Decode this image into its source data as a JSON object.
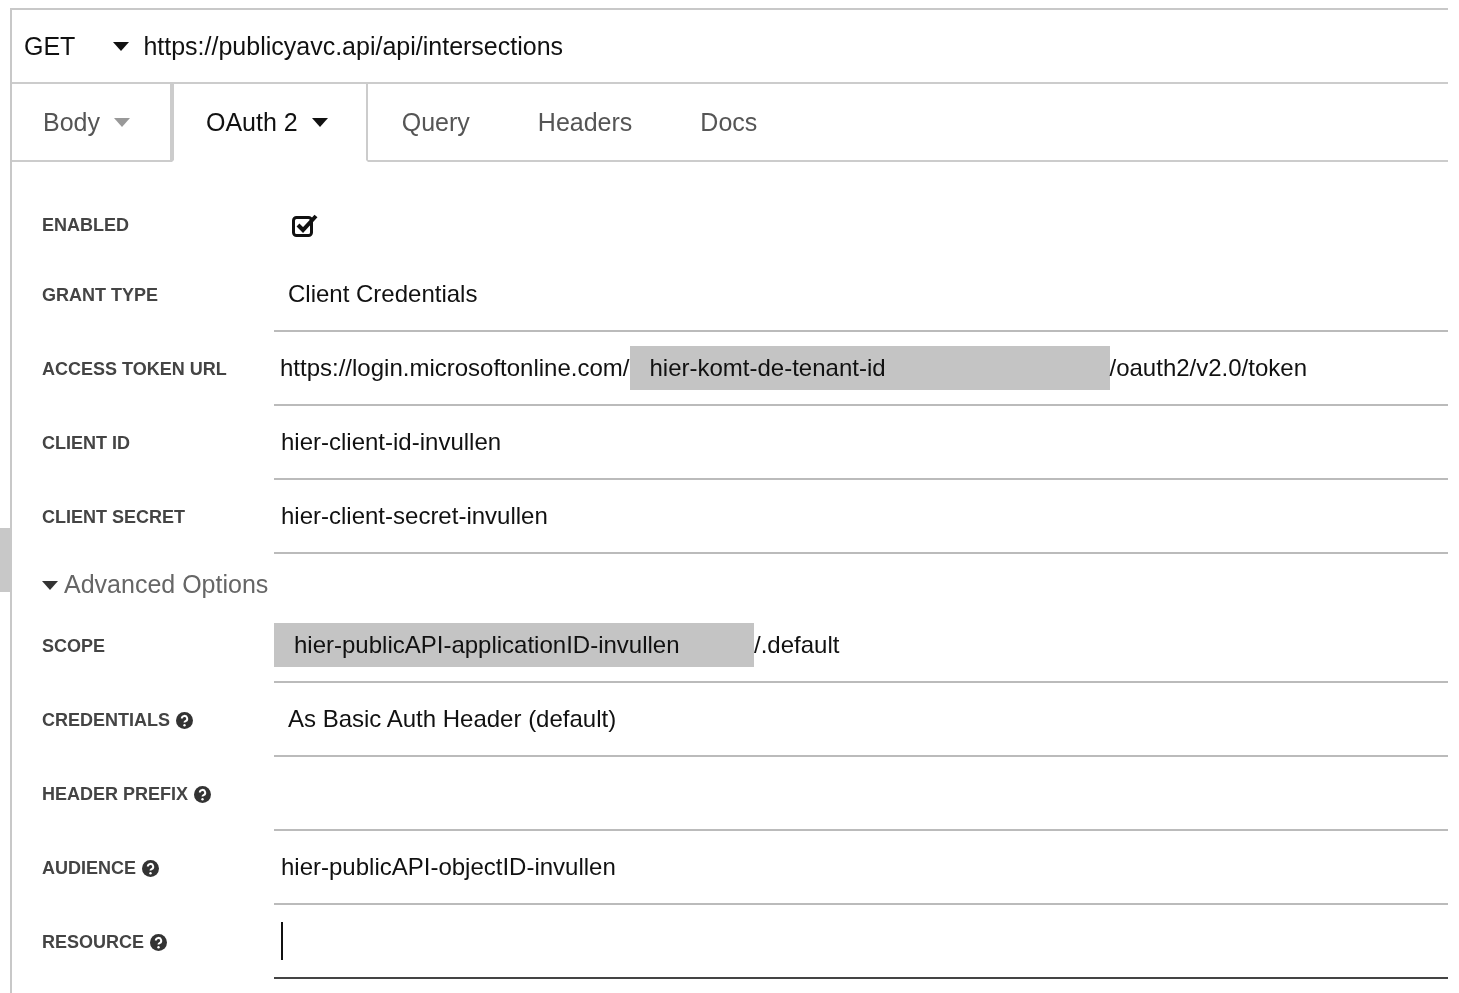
{
  "request": {
    "method": "GET",
    "url": "https://publicyavc.api/api/intersections"
  },
  "tabs": [
    {
      "label": "Body",
      "selected": false,
      "has_menu": true
    },
    {
      "label": "OAuth 2",
      "selected": true,
      "has_menu": true
    },
    {
      "label": "Query",
      "selected": false,
      "has_menu": false
    },
    {
      "label": "Headers",
      "selected": false,
      "has_menu": false
    },
    {
      "label": "Docs",
      "selected": false,
      "has_menu": false
    }
  ],
  "fields": [
    {
      "kind": "checkbox",
      "label": "ENABLED",
      "help": false,
      "checked": true
    },
    {
      "kind": "select",
      "label": "GRANT TYPE",
      "help": false,
      "value": "Client Credentials"
    },
    {
      "kind": "segments",
      "label": "ACCESS TOKEN URL",
      "help": false,
      "segments": [
        {
          "text": "https://login.microsoftonline.com/",
          "highlighted": false
        },
        {
          "text": "hier-komt-de-tenant-id",
          "highlighted": true
        },
        {
          "text": "/oauth2/v2.0/token",
          "highlighted": false
        }
      ]
    },
    {
      "kind": "text",
      "label": "CLIENT ID",
      "help": false,
      "value": "hier-client-id-invullen",
      "focused": false
    },
    {
      "kind": "text",
      "label": "CLIENT SECRET",
      "help": false,
      "value": "hier-client-secret-invullen",
      "focused": false
    }
  ],
  "advanced": {
    "label": "Advanced Options",
    "expanded": true
  },
  "advanced_fields": [
    {
      "kind": "segments",
      "label": "SCOPE",
      "help": false,
      "segments": [
        {
          "text": "hier-publicAPI-applicationID-invullen",
          "highlighted": true
        },
        {
          "text": "/.default",
          "highlighted": false
        }
      ]
    },
    {
      "kind": "select",
      "label": "CREDENTIALS",
      "help": true,
      "value": "As Basic Auth Header (default)"
    },
    {
      "kind": "text",
      "label": "HEADER PREFIX",
      "help": true,
      "focused": false
    },
    {
      "kind": "text",
      "label": "AUDIENCE",
      "help": true,
      "value": "hier-publicAPI-objectID-invullen",
      "focused": false
    },
    {
      "kind": "text",
      "label": "RESOURCE",
      "help": true,
      "focused": true
    }
  ]
}
